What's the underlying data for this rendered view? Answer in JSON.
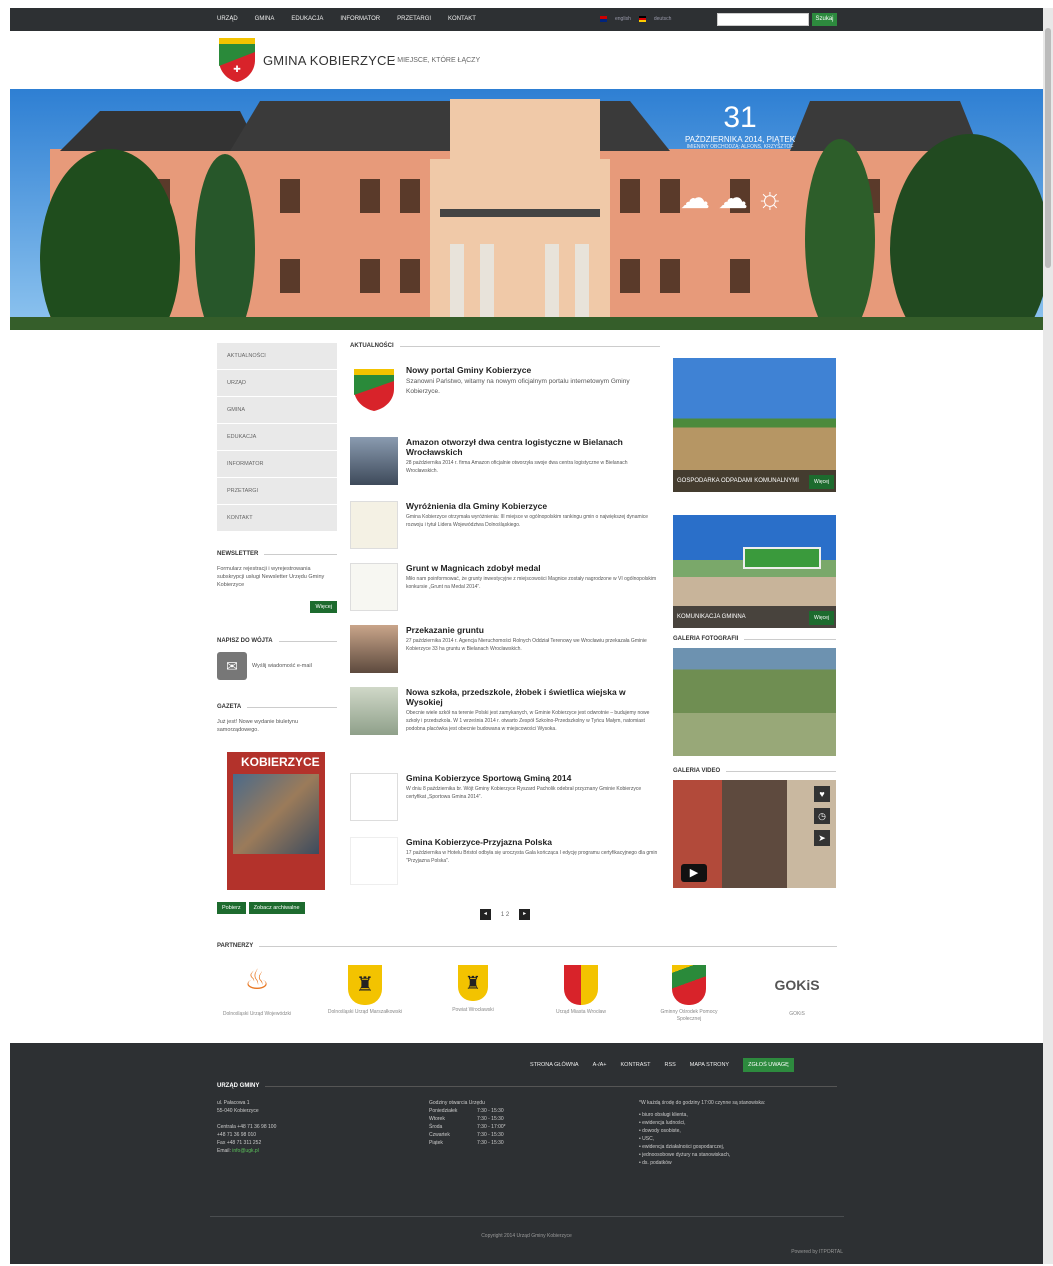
{
  "topbar": {
    "nav": [
      "Urząd",
      "Gmina",
      "Edukacja",
      "Informator",
      "Przetargi",
      "Kontakt"
    ],
    "lang": [
      "english",
      "deutsch"
    ],
    "search_placeholder": "",
    "search_btn": "Szukaj"
  },
  "header": {
    "brand": "GMINA KOBIERZYCE",
    "tagline": "- MIEJSCE, KTÓRE ŁĄCZY"
  },
  "hero": {
    "day": "31",
    "date": "PAŹDZIERNIKA 2014, PIĄTEK",
    "sub": "IMIENINY OBCHODZĄ: ALFONS, KRZYSZTOF"
  },
  "leftnav": [
    "Aktualności",
    "Urząd",
    "Gmina",
    "Edukacja",
    "Informator",
    "Przetargi",
    "Kontakt"
  ],
  "newsletter": {
    "title": "NEWSLETTER",
    "text": "Formularz rejestracji i wyrejestrowania subskrypcji usługi Newsletter Urzędu Gminy Kobierzyce",
    "btn": "Więcej"
  },
  "wojt": {
    "title": "NAPISZ DO WÓJTA",
    "text": "Wyślij wiadomość e-mail"
  },
  "gazeta": {
    "title": "GAZETA",
    "text": "Już jest! Nowe wydanie biuletynu samorządowego.",
    "cover": "KOBIERZYCE",
    "btn1": "Pobierz",
    "btn2": "Zobacz archiwalne"
  },
  "main": {
    "section": "AKTUALNOŚCI",
    "items": [
      {
        "title": "Nowy portal Gminy Kobierzyce",
        "text": "Szanowni Państwo, witamy na nowym oficjalnym portalu internetowym Gminy Kobierzyce."
      },
      {
        "title": "Amazon otworzył dwa centra logistyczne w Bielanach Wrocławskich",
        "text": "28 października 2014 r. firma Amazon oficjalnie otworzyła swoje dwa centra logistyczne w Bielanach Wrocławskich."
      },
      {
        "title": "Wyróżnienia dla Gminy Kobierzyce",
        "text": "Gmina Kobierzyce otrzymała wyróżnienia: III miejsce w ogólnopolskim rankingu gmin o największej dynamice rozwoju i tytuł Lidera Województwa Dolnośląskiego."
      },
      {
        "title": "Grunt w Magnicach zdobył medal",
        "text": "Miło nam poinformować, że grunty inwestycyjne z miejscowości Magnice zostały nagrodzone w VI ogólnopolskim konkursie „Grunt na Medal 2014”."
      },
      {
        "title": "Przekazanie gruntu",
        "text": "27 października 2014 r. Agencja Nieruchomości Rolnych Oddział Terenowy we Wrocławiu przekazała Gminie Kobierzyce 33 ha gruntu w Bielanach Wrocławskich."
      },
      {
        "title": "Nowa szkoła, przedszkole, żłobek i świetlica wiejska w Wysokiej",
        "text": "Obecnie wiele szkół na terenie Polski jest zamykanych, w Gminie Kobierzyce jest odwrotnie – budujemy nowe szkoły i przedszkola. W 1 września 2014 r. otwarto Zespół Szkolno-Przedszkolny w Tyńcu Małym, natomiast podobna placówka jest obecnie budowana w miejscowości Wysoka."
      },
      {
        "title": "Gmina Kobierzyce Sportową Gminą 2014",
        "text": "W dniu 8 października br. Wójt Gminy Kobierzyce Ryszard Pacholik odebrał przyznany Gminie Kobierzyce certyfikat „Sportowa Gmina 2014”."
      },
      {
        "title": "Gmina Kobierzyce-Przyjazna Polska",
        "text": "17 października w Hotelu Bristol odbyła się uroczysta Gala kończąca I edycję programu certyfikacyjnego dla gmin \"Przyjazna Polska\"."
      }
    ],
    "pages": "1 2"
  },
  "right": {
    "box1": "GOSPODARKA ODPADAMI KOMUNALNYMI",
    "box2": "KOMUNIKACJA GMINNA",
    "more": "Więcej",
    "photos": "GALERIA FOTOGRAFII",
    "video": "GALERIA VIDEO"
  },
  "partners": {
    "title": "PARTNERZY",
    "items": [
      "Dolnośląski Urząd Wojewódzki",
      "Dolnośląski Urząd Marszałkowski",
      "Powiat Wrocławski",
      "Urząd Miasta Wrocław",
      "Gminny Ośrodek Pomocy Społecznej",
      "GOKiS"
    ]
  },
  "footer": {
    "links": [
      "STRONA GŁÓWNA",
      "A-/A+",
      "KONTRAST",
      "RSS",
      "MAPA STRONY"
    ],
    "zglos": "ZGŁOŚ UWAGĘ",
    "title": "URZĄD GMINY",
    "address": [
      "ul. Pałacowa 1",
      "55-040 Kobierzyce"
    ],
    "contact": [
      "Centrala +48 71 36 98 100",
      "+48 71 36 98 010",
      "Fax +48 71 311 252",
      "Email: "
    ],
    "email": "info@ugk.pl",
    "hours_title": "Godziny otwarcia Urzędu",
    "hours": [
      [
        "Poniedziałek",
        "7:30 - 15:30"
      ],
      [
        "Wtorek",
        "7:30 - 15:30"
      ],
      [
        "Środa",
        "7:30 - 17:00*"
      ],
      [
        "Czwartek",
        "7:30 - 15:30"
      ],
      [
        "Piątek",
        "7:30 - 15:30"
      ]
    ],
    "note": "*W każdą środę do godziny 17:00 czynne są stanowiska:",
    "list": [
      "biuro obsługi klienta,",
      "ewidencja ludności,",
      "dowody osobiste,",
      "USC,",
      "ewidencja działalności gospodarczej,",
      "jednoosobowe dyżury na stanowiskach,",
      "ds. podatków"
    ],
    "copyright": "Copyright 2014 Urząd Gminy Kobierzyce",
    "powered": "Powered by ITPORTAL"
  }
}
